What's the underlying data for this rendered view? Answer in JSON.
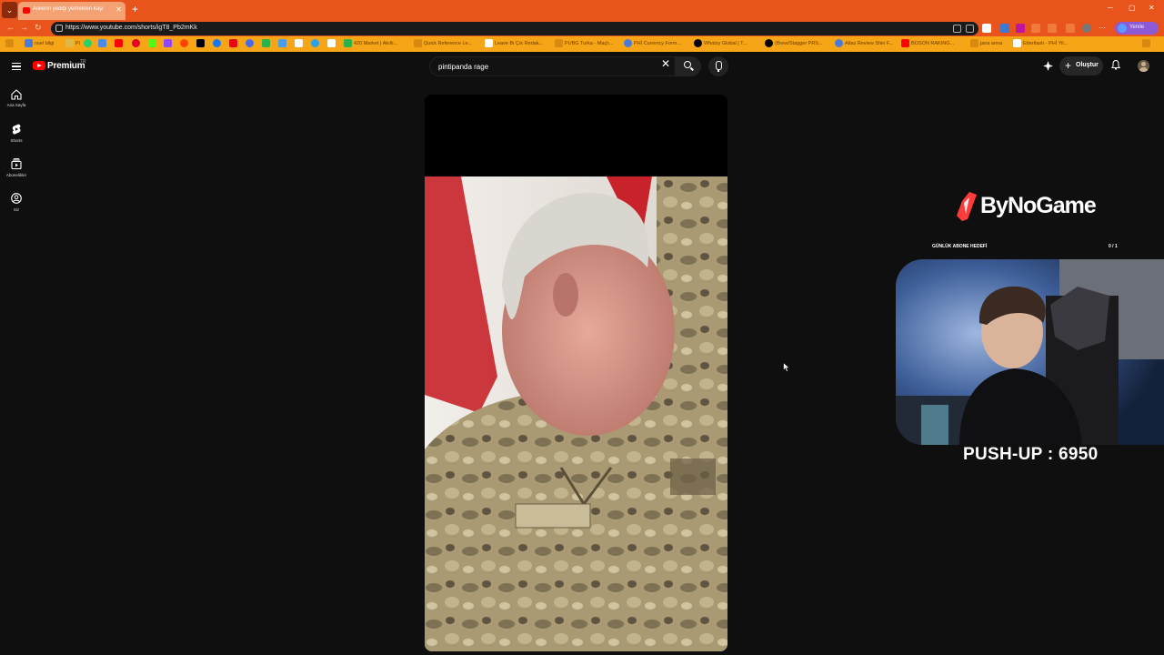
{
  "browser": {
    "tab_title": "Askerin yediği yemekten kaşı",
    "tab_close": "✕",
    "new_tab": "+",
    "url": "https://www.youtube.com/shorts/igT8_Pb2mKk",
    "win_min": "─",
    "win_max": "▢",
    "win_close": "✕",
    "profile_label": "Yenile",
    "bookmarks": [
      "nsel bilgi",
      "Pi",
      "Gmail",
      "",
      "",
      "",
      "",
      "",
      "",
      "",
      "",
      "",
      "",
      "",
      "",
      "",
      "420 Market | Akıllı...",
      "Quick Reference Le...",
      "Leave Bi Çık Redak...",
      "PUBG Turka - Maçlı...",
      "PHİ Currency Form...",
      "Whatsy Global | T...",
      "(Brew/Stagger PRS...",
      "Atlas Review Shin F...",
      "BOSON RAKING...",
      "jana anna",
      "Ettertlash - PHİ Yil..."
    ]
  },
  "youtube": {
    "brand": "Premium",
    "region": "TR",
    "search_query": "pintipanda rage",
    "create_label": "Oluştur",
    "sidebar": [
      {
        "label": "Ana Sayfa",
        "icon": "home-icon"
      },
      {
        "label": "Shorts",
        "icon": "shorts-icon"
      },
      {
        "label": "Abonelikler",
        "icon": "subscriptions-icon"
      },
      {
        "label": "Siz",
        "icon": "you-icon"
      }
    ]
  },
  "overlay": {
    "brand": "ByNoGame",
    "sub_goal_label": "GÜNLÜK ABONE HEDEFİ",
    "sub_goal_count": "0 / 1",
    "pushup_text": "PUSH-UP : 6950"
  },
  "colors": {
    "browser_accent": "#e8541b",
    "bookmark_bar": "#f5a515",
    "yt_bg": "#0f0f0f",
    "yt_red": "#ff0000"
  }
}
